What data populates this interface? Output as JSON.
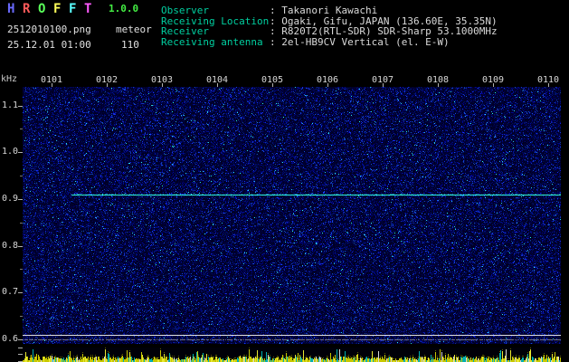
{
  "header": {
    "title_letters": [
      {
        "ch": "H",
        "color": "#6a6aff"
      },
      {
        "ch": "R",
        "color": "#ff5a5a"
      },
      {
        "ch": "O",
        "color": "#5aff5a"
      },
      {
        "ch": "F",
        "color": "#ffff5a"
      },
      {
        "ch": "F",
        "color": "#5affff"
      },
      {
        "ch": "T",
        "color": "#ff5aff"
      }
    ],
    "version": "1.0.0",
    "filename": "2512010100.png",
    "mode": "meteor",
    "timestamp": "25.12.01 01:00",
    "count": "110",
    "info": [
      {
        "label": "Observer",
        "value": ": Takanori Kawachi"
      },
      {
        "label": "Receiving Location",
        "value": ": Ogaki, Gifu, JAPAN (136.60E, 35.35N)"
      },
      {
        "label": "Receiver",
        "value": ": R820T2(RTL-SDR) SDR-Sharp 53.1000MHz"
      },
      {
        "label": "Receiving antenna",
        "value": ": 2el-HB9CV Vertical (el. E-W)"
      }
    ]
  },
  "chart_data": {
    "type": "heatmap",
    "title": "",
    "xlabel": "",
    "ylabel": "kHz",
    "y_unit": "kHz",
    "x_ticks": [
      "0101",
      "0102",
      "0103",
      "0104",
      "0105",
      "0106",
      "0107",
      "0108",
      "0109",
      "0110"
    ],
    "y_ticks": [
      "1.1",
      "1.0",
      "0.9",
      "0.8",
      "0.7",
      "0.6"
    ],
    "ylim": [
      0.59,
      1.14
    ],
    "carrier_line_khz": 0.91,
    "carrier_start_fraction": 0.09,
    "baseline_lines_khz": [
      0.61,
      0.6
    ],
    "legend": "none",
    "grid": false,
    "colors": {
      "noise_background": "#000020",
      "noise_speckle": "#2040c0",
      "carrier_line": "#30e8c8",
      "reference_line": "#e0e0e0",
      "strip_yellow": "#c8c800",
      "strip_cyan": "#00b0b0",
      "label_teal": "#00cfa0",
      "text": "#dadada",
      "version_green": "#44ee44"
    }
  }
}
